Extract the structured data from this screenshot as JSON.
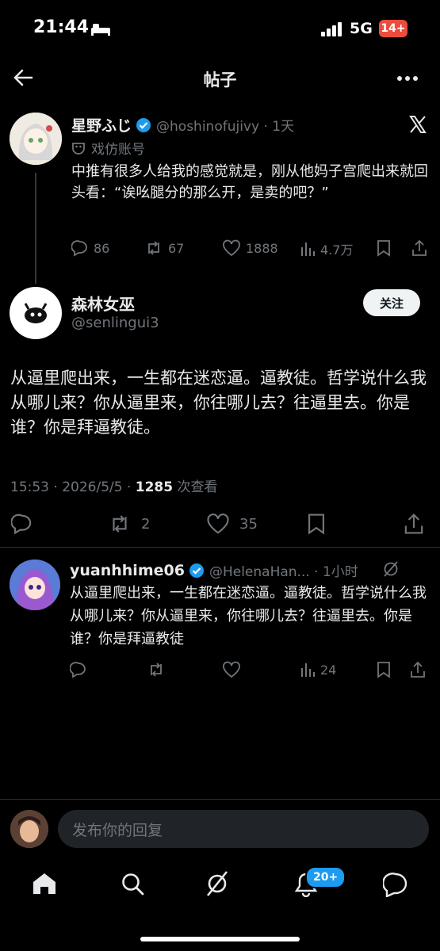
{
  "status_bar": {
    "time": "21:44",
    "network": "5G",
    "battery": "14+"
  },
  "header": {
    "title": "帖子"
  },
  "quoted_post": {
    "display_name": "星野ふじ",
    "handle_time": "@hoshinofujivy · 1天",
    "label": "戏仿账号",
    "text": "中推有很多人给我的感觉就是，刚从他妈子宫爬出来就回头看：“诶吆腿分的那么开，是卖的吧？”",
    "replies": "86",
    "reposts": "67",
    "likes": "1888",
    "views": "4.7万"
  },
  "main_post": {
    "display_name": "森林女巫",
    "handle": "@senlingui3",
    "follow_label": "关注",
    "text": "从逼里爬出来，一生都在迷恋逼。逼教徒。哲学说什么我从哪儿来？你从逼里来，你往哪儿去？往逼里去。你是谁？你是拜逼教徒。",
    "meta_prefix": "15:53 · 2026/5/5 · ",
    "views_count": "1285",
    "views_label": " 次查看",
    "reposts": "2",
    "likes": "35"
  },
  "reply": {
    "display_name": "yuanhhime06",
    "handle_time": "@HelenaHan... · 1小时",
    "text": "从逼里爬出来，一生都在迷恋逼。逼教徒。哲学说什么我从哪儿来？你从逼里来，你往哪儿去？往逼里去。你是谁？你是拜逼教徒",
    "views": "24"
  },
  "compose": {
    "placeholder": "发布你的回复"
  },
  "bottom_nav": {
    "notifications_badge": "20+"
  },
  "colors": {
    "background": "#000000",
    "accent": "#1d9bf0",
    "muted": "#71767b",
    "text": "#e7e9ea"
  }
}
